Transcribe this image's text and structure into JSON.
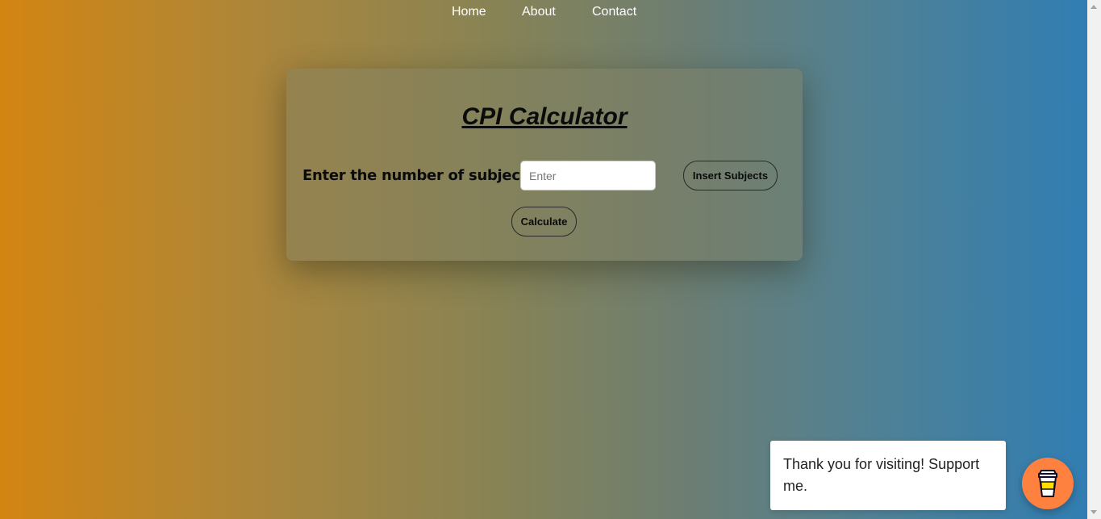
{
  "nav": {
    "items": [
      {
        "label": "Home"
      },
      {
        "label": "About"
      },
      {
        "label": "Contact"
      }
    ]
  },
  "calculator": {
    "title": "CPI Calculator",
    "subjects_label": "Enter the number of subjects:",
    "subjects_input": {
      "value": "",
      "placeholder": "Enter"
    },
    "insert_button": "Insert Subjects",
    "calculate_button": "Calculate"
  },
  "support": {
    "message": "Thank you for visiting! Support me.",
    "button_icon": "coffee-cup-icon",
    "button_color": "#ff813f"
  },
  "colors": {
    "gradient_start": "#d38512",
    "gradient_end": "#2f7db4"
  }
}
